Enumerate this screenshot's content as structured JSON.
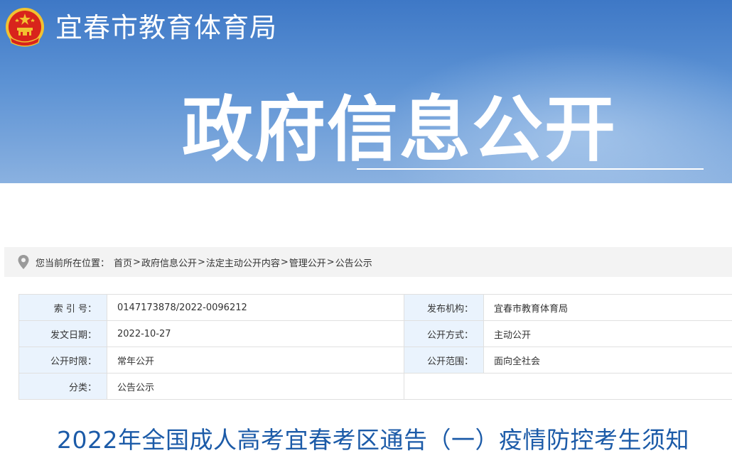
{
  "header": {
    "site_title": "宜春市教育体育局",
    "hero_title": "政府信息公开",
    "emblem_icon": "national-emblem-icon"
  },
  "breadcrumb": {
    "location_label": "您当前所在位置：",
    "items": [
      "首页",
      "政府信息公开",
      "法定主动公开内容",
      "管理公开",
      "公告公示"
    ],
    "separator": ">"
  },
  "meta": {
    "index_label": "索 引 号：",
    "index_value": "0147173878/2022-0096212",
    "publisher_label": "发布机构：",
    "publisher_value": "宜春市教育体育局",
    "date_label": "发文日期：",
    "date_value": "2022-10-27",
    "mode_label": "公开方式：",
    "mode_value": "主动公开",
    "period_label": "公开时限：",
    "period_value": "常年公开",
    "scope_label": "公开范围：",
    "scope_value": "面向全社会",
    "category_label": "分类：",
    "category_value": "公告公示"
  },
  "article": {
    "title": "2022年全国成人高考宜春考区通告（一）疫情防控考生须知"
  },
  "colors": {
    "banner_top": "#3e78c6",
    "banner_bottom": "#8ab1e0",
    "title_blue": "#1c5ba8",
    "label_bg": "#eaf3fd"
  }
}
